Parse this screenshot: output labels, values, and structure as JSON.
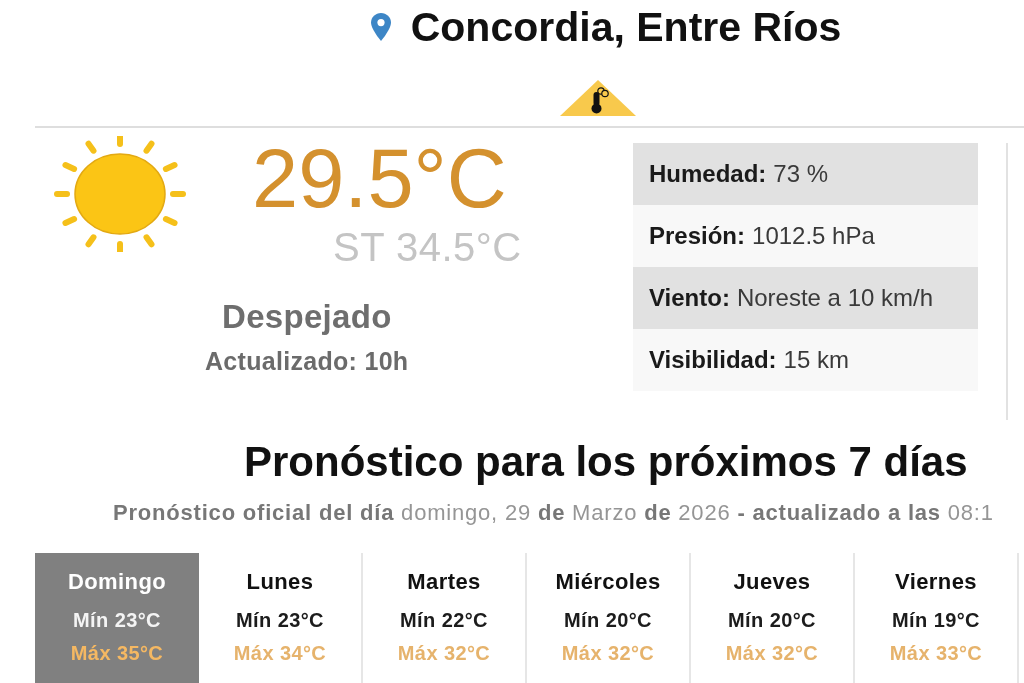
{
  "location": {
    "title": "Concordia, Entre Ríos"
  },
  "current": {
    "temperature": "29.5°C",
    "feels_like": "ST 34.5°C",
    "condition": "Despejado",
    "updated": "Actualizado: 10h"
  },
  "details": [
    {
      "label": "Humedad:",
      "value": "73 %"
    },
    {
      "label": "Presión:",
      "value": "1012.5 hPa"
    },
    {
      "label": "Viento:",
      "value": "Noreste a 10 km/h"
    },
    {
      "label": "Visibilidad:",
      "value": "15 km"
    }
  ],
  "forecast": {
    "title": "Pronóstico para los próximos 7 días",
    "subtitle": "**Pronóstico oficial del día** domingo, 29 **de** Marzo **de** 2026 **- actualizado a las** 08:1",
    "days": [
      {
        "name": "Domingo",
        "min": "Mín 23°C",
        "max": "Máx 35°C",
        "selected": true
      },
      {
        "name": "Lunes",
        "min": "Mín 23°C",
        "max": "Máx 34°C",
        "selected": false
      },
      {
        "name": "Martes",
        "min": "Mín 22°C",
        "max": "Máx 32°C",
        "selected": false
      },
      {
        "name": "Miércoles",
        "min": "Mín 20°C",
        "max": "Máx 32°C",
        "selected": false
      },
      {
        "name": "Jueves",
        "min": "Mín 20°C",
        "max": "Máx 32°C",
        "selected": false
      },
      {
        "name": "Viernes",
        "min": "Mín 19°C",
        "max": "Máx 33°C",
        "selected": false
      }
    ]
  }
}
